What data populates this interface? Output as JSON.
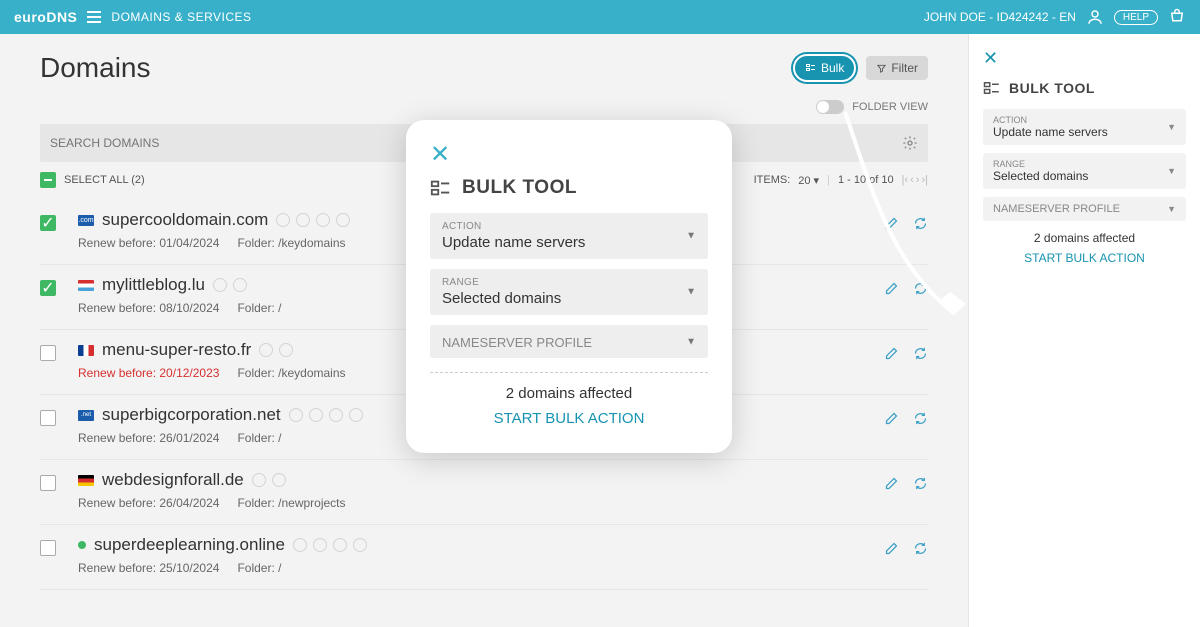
{
  "topbar": {
    "logo": "euroDNS",
    "breadcrumb": "DOMAINS & SERVICES",
    "user": "JOHN DOE - ID424242 - EN",
    "help": "HELP"
  },
  "page": {
    "title": "Domains",
    "bulk_btn": "Bulk",
    "filter_btn": "Filter",
    "folder_view": "FOLDER VIEW",
    "search_placeholder": "SEARCH DOMAINS",
    "select_all": "SELECT ALL (2)"
  },
  "pagination": {
    "items_label": "ITEMS:",
    "per_page": "20",
    "range": "1 - 10 of 10"
  },
  "domains": [
    {
      "flag": "com",
      "flag_text": ".com",
      "name": "supercooldomain.com",
      "renew": "Renew before: 01/04/2024",
      "folder": "Folder: /keydomains",
      "checked": true,
      "icons": 4
    },
    {
      "flag": "lu",
      "name": "mylittleblog.lu",
      "renew": "Renew before: 08/10/2024",
      "folder": "Folder: /",
      "checked": true,
      "icons": 2
    },
    {
      "flag": "fr",
      "name": "menu-super-resto.fr",
      "renew": "Renew before: 20/12/2023",
      "folder": "Folder: /keydomains",
      "checked": false,
      "expired": true,
      "icons": 2
    },
    {
      "flag": "net",
      "flag_text": ".net",
      "name": "superbigcorporation.net",
      "renew": "Renew before: 26/01/2024",
      "folder": "Folder: /",
      "checked": false,
      "icons": 4
    },
    {
      "flag": "de",
      "name": "webdesignforall.de",
      "renew": "Renew before: 26/04/2024",
      "folder": "Folder: /newprojects",
      "checked": false,
      "icons": 2
    },
    {
      "flag": "online",
      "name": "superdeeplearning.online",
      "renew": "Renew before: 25/10/2024",
      "folder": "Folder: /",
      "checked": false,
      "icons": 4
    }
  ],
  "modal": {
    "title": "BULK TOOL",
    "action_label": "ACTION",
    "action_value": "Update name servers",
    "range_label": "RANGE",
    "range_value": "Selected domains",
    "profile_label": "NAMESERVER PROFILE",
    "affected": "2 domains affected",
    "start": "START BULK ACTION"
  },
  "side": {
    "title": "BULK TOOL",
    "action_label": "ACTION",
    "action_value": "Update name servers",
    "range_label": "RANGE",
    "range_value": "Selected domains",
    "profile_label": "NAMESERVER PROFILE",
    "affected": "2 domains affected",
    "start": "START BULK ACTION"
  }
}
